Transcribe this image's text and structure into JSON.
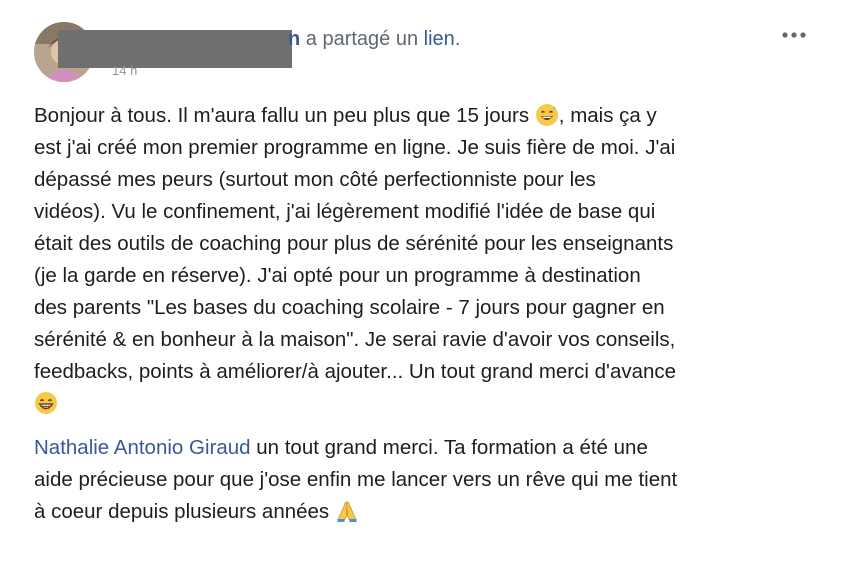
{
  "post": {
    "author_tail": "n",
    "shared_text": "a partagé un",
    "link_label": "lien",
    "after_link": ".",
    "timestamp": "14 h",
    "more_label": "•••",
    "body_lines": [
      "Bonjour à tous. Il m'aura fallu un peu plus que 15 jours",
      ", mais ça y",
      "est j'ai créé mon premier programme en ligne. Je suis fière de moi. J'ai",
      "dépassé mes peurs (surtout mon côté perfectionniste pour les",
      "vidéos). Vu le confinement, j'ai légèrement modifié l'idée de base qui",
      "était des outils de coaching pour plus de sérénité pour les enseignants",
      "(je la garde en réserve). J'ai opté pour un programme à destination",
      "des parents \"Les bases du coaching scolaire - 7 jours pour gagner en",
      "sérénité & en bonheur à la maison\". Je serai ravie d'avoir vos conseils,",
      "feedbacks, points à améliorer/à ajouter... Un tout grand merci d'avance"
    ],
    "emojis": [
      "grinning-sweat-emoji",
      "beaming-grin-emoji",
      "folded-hands-emoji"
    ]
  },
  "comment": {
    "mention": "Nathalie Antonio Giraud",
    "line1_rest": " un tout grand merci. Ta formation a été une",
    "line2": "aide précieuse pour que j'ose enfin me lancer vers un rêve qui me tient",
    "line3": "à coeur depuis plusieurs années "
  },
  "colors": {
    "link": "#385898",
    "text": "#1c1e21",
    "meta": "#606770",
    "redaction": "#6f6f6f"
  }
}
